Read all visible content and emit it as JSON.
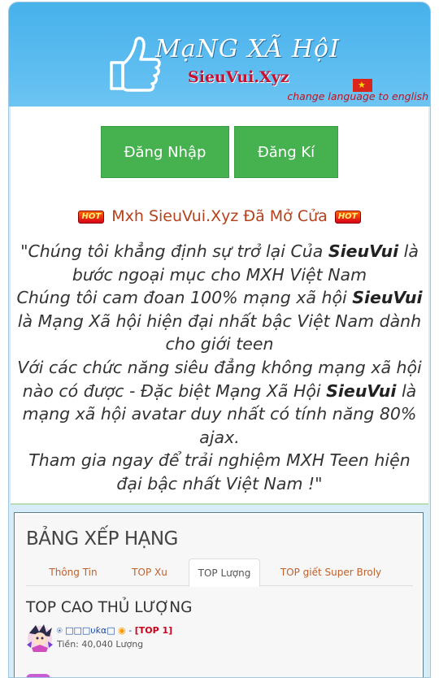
{
  "header": {
    "logo_title": "MạNG XÃ HộI",
    "logo_site": "SieuVui.Xyz",
    "change_language": "change language to english",
    "flag_icon": "vietnam-flag-icon"
  },
  "auth": {
    "login_label": "Đăng Nhập",
    "register_label": "Đăng Kí"
  },
  "announcement": {
    "badge": "HOT",
    "text": "Mxh SieuVui.Xyz Đã Mở Cửa"
  },
  "quote": {
    "l1a": "\"Chúng tôi khẳng định sự trở lại Của ",
    "brand": "SieuVui",
    "l1b": " là bước ngoại mục cho MXH Việt Nam",
    "l2a": "Chúng tôi cam đoan 100% mạng xã hội ",
    "l2b": " là Mạng Xã hội hiện đại nhất bậc Việt Nam dành cho giới teen",
    "l3a": "Với các chức năng siêu đẳng không mạng xã hội nào có được - Đặc biệt Mạng Xã Hội ",
    "l3b": " là mạng xã hội avatar duy nhất có tính năng 80% ajax.",
    "l4": "Tham gia ngay để trải nghiệm MXH Teen hiện đại bậc nhất Việt Nam !\""
  },
  "ranking": {
    "title": "BẢNG XẾP HẠNG",
    "tabs": [
      {
        "label": "Thông Tin",
        "active": false
      },
      {
        "label": "TOP Xu",
        "active": false
      },
      {
        "label": "TOP Lượng",
        "active": true
      },
      {
        "label": "TOP giết Super Broly",
        "active": false
      }
    ],
    "subtitle": "TOP CAO THỦ LƯỢNG",
    "entries": [
      {
        "name": "⍟ □□□υƙα□",
        "rank": "[TOP 1]",
        "money": "Tiền: 40,040 Lượng"
      }
    ]
  },
  "colors": {
    "header_blue": "#5cbcf0",
    "button_green": "#46b24f",
    "announce_orange": "#b4421d",
    "link_red": "#c1121f"
  }
}
